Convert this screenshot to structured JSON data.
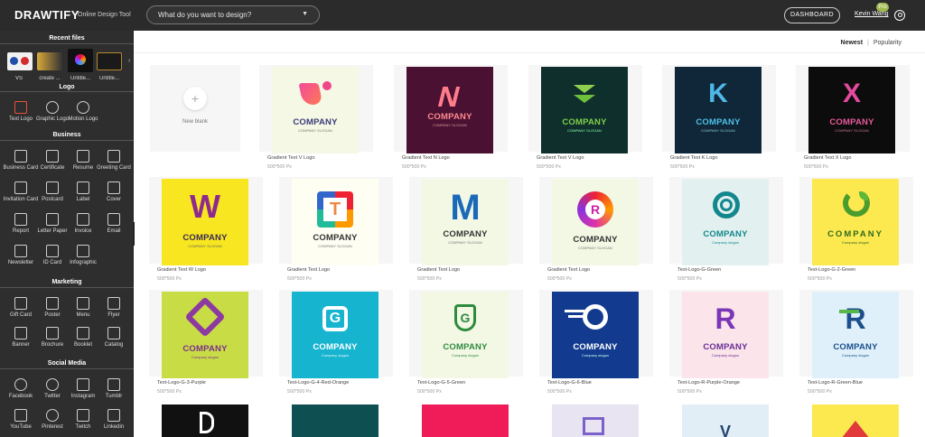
{
  "header": {
    "brand": "DRAWTIFY",
    "tagline": "Online Design Tool",
    "search_placeholder": "What do you want to design?",
    "dashboard_label": "DASHBOARD",
    "user_name": "Kevin Wang",
    "badge": "Pro"
  },
  "sidebar": {
    "recent_title": "Recent files",
    "recent": [
      {
        "label": "VS"
      },
      {
        "label": "create ..."
      },
      {
        "label": "Untitle..."
      },
      {
        "label": "Untitle..."
      }
    ],
    "logo_title": "Logo",
    "logo_items": [
      "Text Logo",
      "Graphic Logo",
      "Motion Logo"
    ],
    "business_title": "Business",
    "business_items": [
      "Business Card",
      "Certificate",
      "Resume",
      "Greeting Card",
      "Invitation Card",
      "Postcard",
      "Label",
      "Cover",
      "Report",
      "Letter Paper",
      "Invoice",
      "Email",
      "Newsletter",
      "ID Card",
      "Infographic"
    ],
    "marketing_title": "Marketing",
    "marketing_items": [
      "Gift Card",
      "Poster",
      "Menu",
      "Flyer",
      "Banner",
      "Brochure",
      "Booklet",
      "Catalog"
    ],
    "social_title": "Social Media",
    "social_items": [
      "Facebook",
      "Twitter",
      "Instagram",
      "Tumblr",
      "YouTube",
      "Pinterest",
      "Twitch",
      "Linkedin"
    ]
  },
  "main": {
    "sort_newest": "Newest",
    "sort_sep": "|",
    "sort_popularity": "Popularity",
    "new_blank": "New blank",
    "size_text": "500*500 Px",
    "company": "COMPANY",
    "slogan_upper": "COMPANY SLOGAN",
    "slogan_lower": "Company slogan",
    "row1": [
      "Gradient Text V Logo",
      "Gradient Text N Logo",
      "Gradient Text V Logo",
      "Gradient Text K Logo",
      "Gradient Text X Logo"
    ],
    "row2": [
      "Gradient Text W Logo",
      "Gradient Text Logo",
      "Gradient Text Logo",
      "Gradient Text Logo",
      "Text-Logo-G-Green",
      "Text-Logo-G-2-Green"
    ],
    "row3": [
      "Text-Logo-G-3-Purple",
      "Text-Logo-G-4-Red-Orange",
      "Text-Logo-G-5-Green",
      "Text-Logo-G-6-Blue",
      "Text-Logo-R-Purple-Orange",
      "Text-Logo-R-Green-Blue"
    ],
    "letters": {
      "g": "G",
      "r": "R",
      "t": "T",
      "v": "V",
      "w": "W",
      "m": "M",
      "k": "K",
      "x": "X",
      "n": "N"
    }
  }
}
